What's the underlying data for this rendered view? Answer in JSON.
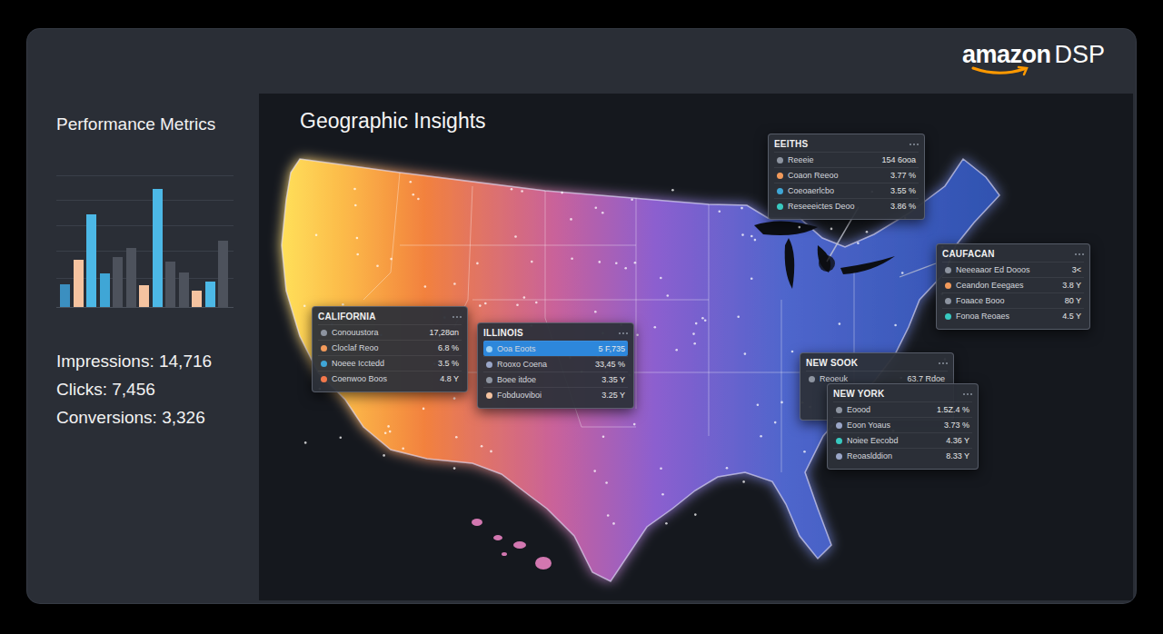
{
  "logo": {
    "brand": "amazon",
    "product": "DSP"
  },
  "sidebar": {
    "title": "Performance Metrics",
    "chart": {
      "bars": [
        {
          "value": 25,
          "color": "#3b8fc0"
        },
        {
          "value": 52,
          "color": "#f5c3a0"
        },
        {
          "value": 102,
          "color": "#4cb8e6"
        },
        {
          "value": 37,
          "color": "#3fa6d6"
        },
        {
          "value": 55,
          "color": "#4d525c"
        },
        {
          "value": 65,
          "color": "#4d525c"
        },
        {
          "value": 24,
          "color": "#f5c3a0"
        },
        {
          "value": 130,
          "color": "#4cb8e6"
        },
        {
          "value": 50,
          "color": "#4d525c"
        },
        {
          "value": 38,
          "color": "#4d525c"
        },
        {
          "value": 18,
          "color": "#f5c3a0"
        },
        {
          "value": 28,
          "color": "#4cb8e6"
        },
        {
          "value": 73,
          "color": "#4d525c"
        }
      ]
    },
    "metrics": [
      "Impressions: 14,716",
      "Clicks: 7,456",
      "Conversions: 3,326"
    ]
  },
  "map": {
    "title": "Geographic Insights",
    "cards": [
      {
        "title": "EEITHS",
        "rows": [
          {
            "label": "Reeeie",
            "value": "154 6ooa",
            "color": "#8d94a0",
            "selected": false
          },
          {
            "label": "Coaon Reeoo",
            "value": "3.77 %",
            "color": "#f29a5b",
            "selected": false
          },
          {
            "label": "Coeoaerlcbo",
            "value": "3.55 %",
            "color": "#3fa6d6",
            "selected": false
          },
          {
            "label": "Reseeeictes Deoo",
            "value": "3.86 %",
            "color": "#38c9c0",
            "selected": false
          }
        ]
      },
      {
        "title": "CAUFACAN",
        "rows": [
          {
            "label": "Neeeaaor Ed Dooos",
            "value": "3<",
            "color": "#8d94a0",
            "selected": false
          },
          {
            "label": "Ceandon Eeegaes",
            "value": "3.8 Y",
            "color": "#f29a5b",
            "selected": false
          },
          {
            "label": "Foaace Booo",
            "value": "80 Y",
            "color": "#8d94a0",
            "selected": false
          },
          {
            "label": "Fonoa Reoaes",
            "value": "4.5 Y",
            "color": "#38c9c0",
            "selected": false
          }
        ]
      },
      {
        "title": "CALIFORNIA",
        "rows": [
          {
            "label": "Conouustora",
            "value": "17,28ɑn",
            "color": "#8d94a0",
            "selected": false
          },
          {
            "label": "Cloclaf Reoo",
            "value": "6.8 %",
            "color": "#f29a5b",
            "selected": false
          },
          {
            "label": "Noeee Icctedd",
            "value": "3.5 %",
            "color": "#3fa6d6",
            "selected": false
          },
          {
            "label": "Coenwoo Boos",
            "value": "4.8 Y",
            "color": "#f2784b",
            "selected": false
          }
        ]
      },
      {
        "title": "ILLINOIS",
        "rows": [
          {
            "label": "Ooa Eoots",
            "value": "5 F,735",
            "color": "#9fd3f5",
            "selected": true
          },
          {
            "label": "Rooxo Coena",
            "value": "33,45 %",
            "color": "#9aa6c8",
            "selected": false
          },
          {
            "label": "Boee itdoe",
            "value": "3.35 Y",
            "color": "#8d94a0",
            "selected": false
          },
          {
            "label": "Fobduoviboi",
            "value": "3.25 Y",
            "color": "#f5c3a0",
            "selected": false
          }
        ]
      },
      {
        "title": "NEW SOOK",
        "rows": [
          {
            "label": "Reoeuk",
            "value": "63.7 Rdoe",
            "color": "#8d94a0",
            "selected": false
          }
        ]
      },
      {
        "title": "NEW YORK",
        "rows": [
          {
            "label": "Eoood",
            "value": "1.5Z.4 %",
            "color": "#8d94a0",
            "selected": false
          },
          {
            "label": "Eoon Yoaus",
            "value": "3.73 %",
            "color": "#9aa6c8",
            "selected": false
          },
          {
            "label": "Noiee Eecobd",
            "value": "4.36 Y",
            "color": "#38c9c0",
            "selected": false
          },
          {
            "label": "Reoaslddion",
            "value": "8.33 Y",
            "color": "#9aa6c8",
            "selected": false
          }
        ]
      }
    ]
  }
}
